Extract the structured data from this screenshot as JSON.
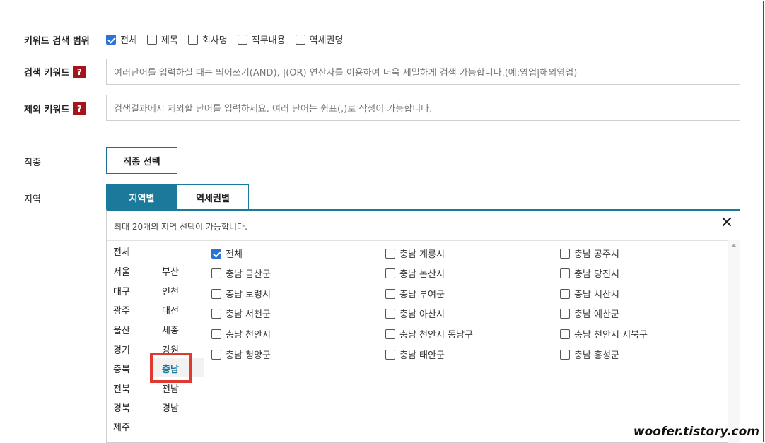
{
  "keyword_scope": {
    "label": "키워드 검색 범위",
    "options": [
      {
        "label": "전체",
        "checked": true
      },
      {
        "label": "제목",
        "checked": false
      },
      {
        "label": "회사명",
        "checked": false
      },
      {
        "label": "직무내용",
        "checked": false
      },
      {
        "label": "역세권명",
        "checked": false
      }
    ]
  },
  "search_keyword": {
    "label": "검색 키워드",
    "help": "?",
    "placeholder": "여러단어를 입력하실 때는 띄어쓰기(AND), |(OR) 연산자를 이용하여 더욱 세밀하게 검색 가능합니다.(예:영업|해외영업)"
  },
  "exclude_keyword": {
    "label": "제외 키워드",
    "help": "?",
    "placeholder": "검색결과에서 제외할 단어를 입력하세요. 여러 단어는 쉼표(,)로 작성이 가능합니다."
  },
  "job": {
    "label": "직종",
    "button": "직종 선택"
  },
  "region": {
    "label": "지역",
    "tabs": [
      "지역별",
      "역세권별"
    ],
    "active_tab": "지역별",
    "note": "최대 20개의 지역 선택이 가능합니다.",
    "close": "✕",
    "list": [
      "전체",
      "서울",
      "부산",
      "대구",
      "인천",
      "광주",
      "대전",
      "울산",
      "세종",
      "경기",
      "강원",
      "충북",
      "충남",
      "전북",
      "전남",
      "경북",
      "경남",
      "제주"
    ],
    "selected": "충남",
    "sub_regions": [
      {
        "label": "전체",
        "checked": true
      },
      {
        "label": "충남 계룡시",
        "checked": false
      },
      {
        "label": "충남 공주시",
        "checked": false
      },
      {
        "label": "충남 금산군",
        "checked": false
      },
      {
        "label": "충남 논산시",
        "checked": false
      },
      {
        "label": "충남 당진시",
        "checked": false
      },
      {
        "label": "충남 보령시",
        "checked": false
      },
      {
        "label": "충남 부여군",
        "checked": false
      },
      {
        "label": "충남 서산시",
        "checked": false
      },
      {
        "label": "충남 서천군",
        "checked": false
      },
      {
        "label": "충남 아산시",
        "checked": false
      },
      {
        "label": "충남 예산군",
        "checked": false
      },
      {
        "label": "충남 천안시",
        "checked": false
      },
      {
        "label": "충남 천안시 동남구",
        "checked": false
      },
      {
        "label": "충남 천안시 서북구",
        "checked": false
      },
      {
        "label": "충남 청양군",
        "checked": false
      },
      {
        "label": "충남 태안군",
        "checked": false
      },
      {
        "label": "충남 홍성군",
        "checked": false
      }
    ]
  },
  "watermark": "woofer.tistory.com"
}
